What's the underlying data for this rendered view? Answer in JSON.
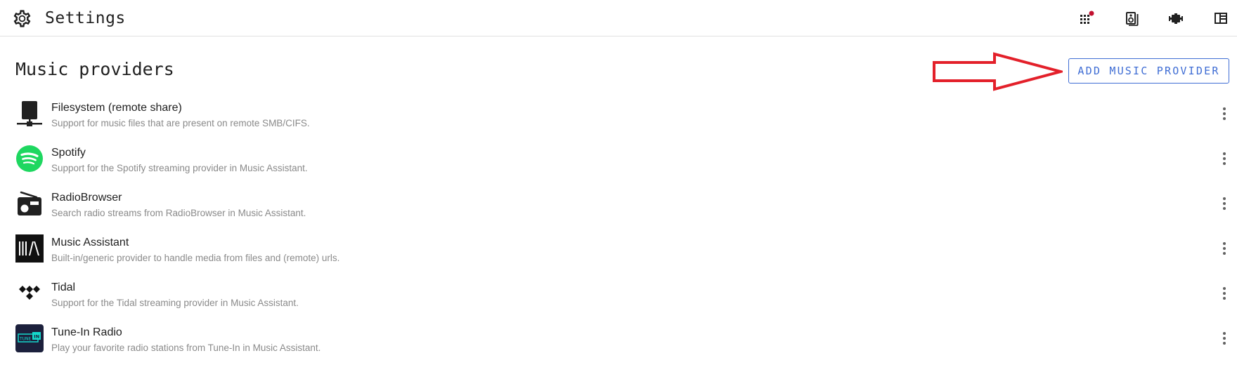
{
  "header": {
    "title": "Settings",
    "icons": [
      "gear-icon",
      "apps-grid-icon",
      "speaker-icon",
      "plugin-icon",
      "account-box-icon"
    ],
    "notification_color": "#c2102f"
  },
  "main": {
    "section_title": "Music providers",
    "add_button_label": "ADD MUSIC PROVIDER",
    "accent_color": "#3f6dd4",
    "annotation_arrow_color": "#e3202a"
  },
  "providers": [
    {
      "name": "Filesystem (remote share)",
      "description": "Support for music files that are present on remote SMB/CIFS.",
      "icon": "network-drive-icon"
    },
    {
      "name": "Spotify",
      "description": "Support for the Spotify streaming provider in Music Assistant.",
      "icon": "spotify-logo-icon"
    },
    {
      "name": "RadioBrowser",
      "description": "Search radio streams from RadioBrowser in Music Assistant.",
      "icon": "radio-icon"
    },
    {
      "name": "Music Assistant",
      "description": "Built-in/generic provider to handle media from files and (remote) urls.",
      "icon": "music-assistant-logo-icon"
    },
    {
      "name": "Tidal",
      "description": "Support for the Tidal streaming provider in Music Assistant.",
      "icon": "tidal-logo-icon"
    },
    {
      "name": "Tune-In Radio",
      "description": "Play your favorite radio stations from Tune-In in Music Assistant.",
      "icon": "tunein-logo-icon",
      "logo_text": "TUNE",
      "logo_badge": "IN"
    }
  ]
}
